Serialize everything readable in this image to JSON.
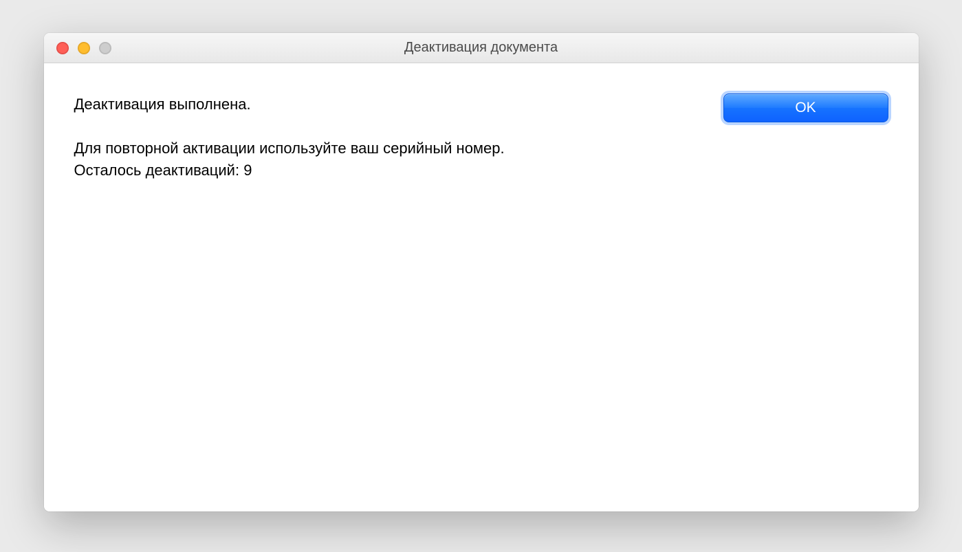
{
  "window": {
    "title": "Деактивация документа"
  },
  "message": {
    "heading": "Деактивация выполнена.",
    "line1": "Для повторной активации используйте ваш серийный номер.",
    "line2": "Осталось деактиваций: 9"
  },
  "buttons": {
    "ok": "OK"
  }
}
